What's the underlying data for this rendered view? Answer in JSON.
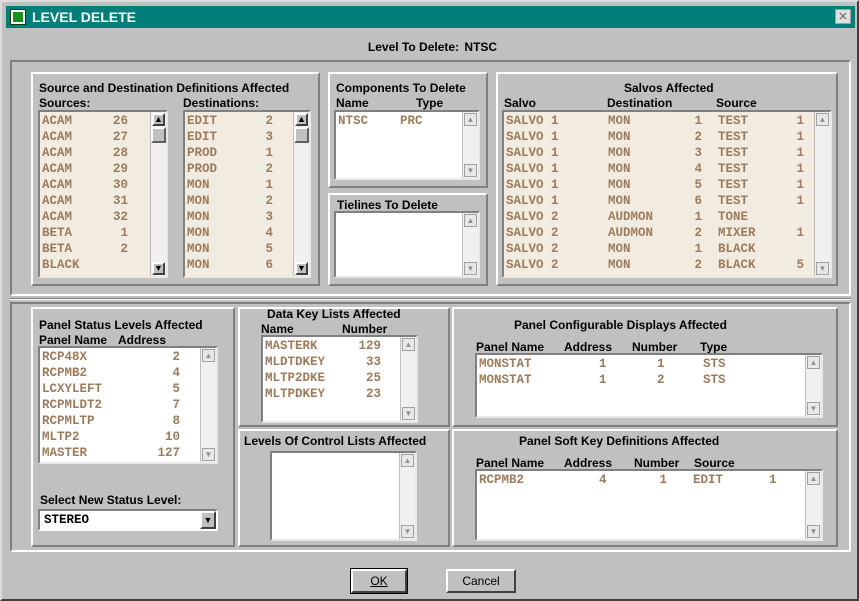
{
  "window": {
    "title": "LEVEL DELETE",
    "close_label": "✕"
  },
  "level_to_delete": {
    "label": "Level To Delete:",
    "value": "NTSC"
  },
  "source_dest": {
    "title": "Source and Destination Definitions Affected",
    "sources_label": "Sources:",
    "destinations_label": "Destinations:",
    "sources": [
      [
        "ACAM",
        "26"
      ],
      [
        "ACAM",
        "27"
      ],
      [
        "ACAM",
        "28"
      ],
      [
        "ACAM",
        "29"
      ],
      [
        "ACAM",
        "30"
      ],
      [
        "ACAM",
        "31"
      ],
      [
        "ACAM",
        "32"
      ],
      [
        "BETA",
        "1"
      ],
      [
        "BETA",
        "2"
      ],
      [
        "BLACK",
        ""
      ]
    ],
    "destinations": [
      [
        "EDIT",
        "2"
      ],
      [
        "EDIT",
        "3"
      ],
      [
        "PROD",
        "1"
      ],
      [
        "PROD",
        "2"
      ],
      [
        "MON",
        "1"
      ],
      [
        "MON",
        "2"
      ],
      [
        "MON",
        "3"
      ],
      [
        "MON",
        "4"
      ],
      [
        "MON",
        "5"
      ],
      [
        "MON",
        "6"
      ]
    ]
  },
  "components": {
    "title": "Components To Delete",
    "headers": [
      "Name",
      "Type"
    ],
    "rows": [
      [
        "NTSC",
        "PRC"
      ]
    ]
  },
  "tielines": {
    "title": "Tielines To Delete",
    "rows": []
  },
  "salvos": {
    "title": "Salvos  Affected",
    "headers": [
      "Salvo",
      "Destination",
      "Source"
    ],
    "rows": [
      [
        "SALVO 1",
        "MON",
        "1",
        "TEST",
        "1"
      ],
      [
        "SALVO 1",
        "MON",
        "2",
        "TEST",
        "1"
      ],
      [
        "SALVO 1",
        "MON",
        "3",
        "TEST",
        "1"
      ],
      [
        "SALVO 1",
        "MON",
        "4",
        "TEST",
        "1"
      ],
      [
        "SALVO 1",
        "MON",
        "5",
        "TEST",
        "1"
      ],
      [
        "SALVO 1",
        "MON",
        "6",
        "TEST",
        "1"
      ],
      [
        "SALVO 2",
        "AUDMON",
        "1",
        "TONE",
        ""
      ],
      [
        "SALVO 2",
        "AUDMON",
        "2",
        "MIXER",
        "1"
      ],
      [
        "SALVO 2",
        "MON",
        "1",
        "BLACK",
        ""
      ],
      [
        "SALVO 2",
        "MON",
        "2",
        "BLACK",
        "5"
      ]
    ]
  },
  "panel_status": {
    "title": "Panel Status Levels Affected",
    "headers": [
      "Panel Name",
      "Address"
    ],
    "rows": [
      [
        "RCP48X",
        "2"
      ],
      [
        "RCPMB2",
        "4"
      ],
      [
        "LCXYLEFT",
        "5"
      ],
      [
        "RCPMLDT2",
        "7"
      ],
      [
        "RCPMLTP",
        "8"
      ],
      [
        "MLTP2",
        "10"
      ],
      [
        "MASTER",
        "127"
      ]
    ]
  },
  "select_status": {
    "label": "Select New Status Level:",
    "value": "STEREO"
  },
  "data_key": {
    "title": "Data Key Lists Affected",
    "headers": [
      "Name",
      "Number"
    ],
    "rows": [
      [
        "MASTERK",
        "129"
      ],
      [
        "MLDTDKEY",
        "33"
      ],
      [
        "MLTP2DKE",
        "25"
      ],
      [
        "MLTPDKEY",
        "23"
      ]
    ]
  },
  "levels_control": {
    "title": "Levels Of Control Lists Affected",
    "rows": []
  },
  "configurable": {
    "title": "Panel Configurable Displays Affected",
    "headers": [
      "Panel Name",
      "Address",
      "Number",
      "Type"
    ],
    "rows": [
      [
        "MONSTAT",
        "1",
        "1",
        "STS"
      ],
      [
        "MONSTAT",
        "1",
        "2",
        "STS"
      ]
    ]
  },
  "soft_key": {
    "title": "Panel Soft Key Definitions Affected",
    "headers": [
      "Panel Name",
      "Address",
      "Number",
      "Source"
    ],
    "rows": [
      [
        "RCPMB2",
        "4",
        "1",
        "EDIT",
        "1"
      ]
    ]
  },
  "buttons": {
    "ok": "OK",
    "cancel": "Cancel"
  },
  "icons": {
    "scroll_up": "▲",
    "scroll_down": "▼",
    "combo_arrow": "▼"
  }
}
